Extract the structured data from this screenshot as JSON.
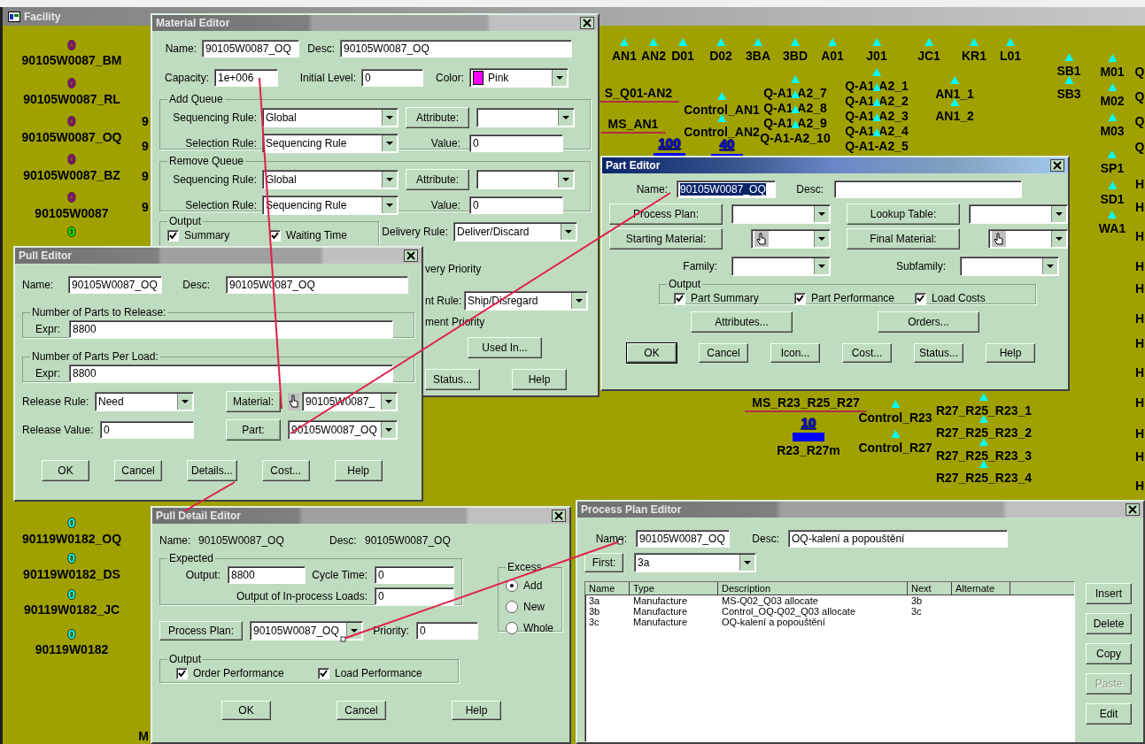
{
  "facility": {
    "title": "Facility",
    "counts": [
      {
        "text": "0",
        "color": "#a800a8",
        "kind": "plain"
      },
      {
        "text": "0",
        "color": "#a800a8",
        "kind": "plain"
      },
      {
        "text": "0",
        "color": "#a800a8",
        "kind": "plain"
      },
      {
        "text": "0",
        "color": "#a800a8",
        "kind": "plain"
      },
      {
        "text": "0",
        "color": "#a800a8",
        "kind": "plain"
      },
      {
        "text": "0",
        "color": "#00ff00",
        "kind": "plain"
      },
      {
        "text": "0",
        "color": "#00ffff",
        "kind": "plain"
      },
      {
        "text": "0",
        "color": "#00ffff",
        "kind": "plain"
      },
      {
        "text": "0",
        "color": "#00ffff",
        "kind": "plain"
      },
      {
        "text": "0",
        "color": "#00ffff",
        "kind": "plain"
      },
      {
        "text": "100",
        "color": "#0000ff",
        "kind": "queue"
      },
      {
        "text": "40",
        "color": "#0000ff",
        "kind": "queue"
      },
      {
        "text": "10",
        "color": "#0000ff",
        "kind": "queue"
      }
    ],
    "labels": [
      {
        "text": "90105W0087_BM",
        "marker": false,
        "underline": false
      },
      {
        "text": "90105W0087_RL",
        "marker": false,
        "underline": false
      },
      {
        "text": "90105W0087_OQ",
        "marker": false,
        "underline": false
      },
      {
        "text": "90105W0087_BZ",
        "marker": false,
        "underline": false
      },
      {
        "text": "90105W0087",
        "marker": false,
        "underline": false
      },
      {
        "text": "90119W0182_OQ",
        "marker": false,
        "underline": false
      },
      {
        "text": "90119W0182_DS",
        "marker": false,
        "underline": false
      },
      {
        "text": "90119W0182_JC",
        "marker": false,
        "underline": false
      },
      {
        "text": "90119W0182",
        "marker": false,
        "underline": false
      },
      {
        "text": "9",
        "marker": false,
        "underline": false
      },
      {
        "text": "9",
        "marker": false,
        "underline": false
      },
      {
        "text": "9",
        "marker": false,
        "underline": false
      },
      {
        "text": "9",
        "marker": false,
        "underline": false
      },
      {
        "text": "M",
        "marker": false,
        "underline": false
      },
      {
        "text": "AN1",
        "marker": true,
        "underline": false
      },
      {
        "text": "AN2",
        "marker": true,
        "underline": false
      },
      {
        "text": "D01",
        "marker": true,
        "underline": false
      },
      {
        "text": "D02",
        "marker": true,
        "underline": false
      },
      {
        "text": "3BA",
        "marker": true,
        "underline": false
      },
      {
        "text": "3BD",
        "marker": true,
        "underline": false
      },
      {
        "text": "A01",
        "marker": true,
        "underline": false
      },
      {
        "text": "J01",
        "marker": true,
        "underline": false
      },
      {
        "text": "JC1",
        "marker": true,
        "underline": false
      },
      {
        "text": "KR1",
        "marker": true,
        "underline": false
      },
      {
        "text": "L01",
        "marker": true,
        "underline": false
      },
      {
        "text": "SB1",
        "marker": true,
        "underline": false
      },
      {
        "text": "SB3",
        "marker": true,
        "underline": false
      },
      {
        "text": "M01",
        "marker": true,
        "underline": false
      },
      {
        "text": "M02",
        "marker": true,
        "underline": false
      },
      {
        "text": "M03",
        "marker": true,
        "underline": false
      },
      {
        "text": "SP1",
        "marker": true,
        "underline": false
      },
      {
        "text": "SD1",
        "marker": true,
        "underline": false
      },
      {
        "text": "WA1",
        "marker": true,
        "underline": false
      },
      {
        "text": "S_Q01-AN2",
        "marker": false,
        "underline": true
      },
      {
        "text": "MS_AN1",
        "marker": false,
        "underline": true
      },
      {
        "text": "Control_AN1",
        "marker": true,
        "underline": false
      },
      {
        "text": "Control_AN2",
        "marker": true,
        "underline": false
      },
      {
        "text": "Q-A1-A2_7",
        "marker": true,
        "underline": false
      },
      {
        "text": "Q-A1-A2_8",
        "marker": true,
        "underline": false
      },
      {
        "text": "Q-A1-A2_9",
        "marker": true,
        "underline": false
      },
      {
        "text": "Q-A1-A2_10",
        "marker": true,
        "underline": false
      },
      {
        "text": "Q-A1-A2_1",
        "marker": true,
        "underline": false
      },
      {
        "text": "Q-A1-A2_2",
        "marker": true,
        "underline": false
      },
      {
        "text": "Q-A1-A2_3",
        "marker": true,
        "underline": false
      },
      {
        "text": "Q-A1-A2_4",
        "marker": true,
        "underline": false
      },
      {
        "text": "Q-A1-A2_5",
        "marker": true,
        "underline": false
      },
      {
        "text": "AN1_1",
        "marker": true,
        "underline": false
      },
      {
        "text": "AN1_2",
        "marker": true,
        "underline": false
      },
      {
        "text": "MS_R23_R25_R27",
        "marker": false,
        "underline": true
      },
      {
        "text": "R23_R27m",
        "marker": false,
        "underline": false
      },
      {
        "text": "Control_R23",
        "marker": true,
        "underline": false
      },
      {
        "text": "Control_R27",
        "marker": true,
        "underline": false
      },
      {
        "text": "R27_R25_R23_1",
        "marker": true,
        "underline": false
      },
      {
        "text": "R27_R25_R23_2",
        "marker": true,
        "underline": false
      },
      {
        "text": "R27_R25_R23_3",
        "marker": true,
        "underline": false
      },
      {
        "text": "R27_R25_R23_4",
        "marker": true,
        "underline": false
      },
      {
        "text": "Q",
        "marker": false,
        "underline": false
      },
      {
        "text": "Q",
        "marker": false,
        "underline": false
      },
      {
        "text": "Q",
        "marker": false,
        "underline": false
      },
      {
        "text": "Q",
        "marker": false,
        "underline": false
      },
      {
        "text": "H",
        "marker": false,
        "underline": false
      },
      {
        "text": "H",
        "marker": false,
        "underline": false
      },
      {
        "text": "H",
        "marker": false,
        "underline": false
      },
      {
        "text": "H",
        "marker": false,
        "underline": false
      },
      {
        "text": "H",
        "marker": false,
        "underline": false
      },
      {
        "text": "H",
        "marker": false,
        "underline": false
      },
      {
        "text": "H",
        "marker": false,
        "underline": false
      },
      {
        "text": "H",
        "marker": false,
        "underline": false
      },
      {
        "text": "H",
        "marker": false,
        "underline": false
      },
      {
        "text": "H",
        "marker": false,
        "underline": false
      },
      {
        "text": "H",
        "marker": false,
        "underline": false
      },
      {
        "text": "H",
        "marker": false,
        "underline": false
      }
    ]
  },
  "material_editor": {
    "title": "Material Editor",
    "name": {
      "label": "Name:",
      "value": "90105W0087_OQ"
    },
    "desc": {
      "label": "Desc:",
      "value": "90105W0087_OQ"
    },
    "capacity": {
      "label": "Capacity:",
      "value": "1e+006"
    },
    "initial_level": {
      "label": "Initial Level:",
      "value": "0"
    },
    "color": {
      "label": "Color:",
      "value": "Pink",
      "color": "#ff00ff"
    },
    "queues": [
      {
        "title": "Add Queue",
        "sequencing_rule": {
          "label": "Sequencing Rule:",
          "value": "Global"
        },
        "selection_rule": {
          "label": "Selection Rule:",
          "value": "Sequencing Rule"
        },
        "attribute_button": "Attribute:",
        "value": {
          "label": "Value:",
          "value": "0"
        }
      },
      {
        "title": "Remove Queue",
        "sequencing_rule": {
          "label": "Sequencing Rule:",
          "value": "Global"
        },
        "selection_rule": {
          "label": "Selection Rule:",
          "value": "Sequencing Rule"
        },
        "attribute_button": "Attribute:",
        "value": {
          "label": "Value:",
          "value": "0"
        }
      }
    ],
    "output": {
      "title": "Output",
      "checks": [
        {
          "label": "Summary",
          "checked": true
        },
        {
          "label": "Waiting Time",
          "checked": true
        }
      ]
    },
    "delivery_rule": {
      "label": "Delivery Rule:",
      "value": "Deliver/Discard"
    },
    "delivery_priority": "very Priority",
    "shipment_rule": {
      "label": "nt Rule:",
      "value": "Ship/Disregard"
    },
    "shipment_priority": "ment Priority",
    "used_in": "Used In...",
    "buttons": [
      "Status...",
      "Help"
    ]
  },
  "part_editor": {
    "title": "Part Editor",
    "name": {
      "label": "Name:",
      "value": "90105W0087_OQ",
      "text_selected": true
    },
    "desc": {
      "label": "Desc:"
    },
    "selectors": [
      {
        "button": "Process Plan:",
        "kind": "plain"
      },
      {
        "button": "Lookup Table:",
        "kind": "plain"
      },
      {
        "button": "Starting Material:",
        "kind": "hand"
      },
      {
        "button": "Final Material:",
        "kind": "hand"
      }
    ],
    "family": {
      "label": "Family:"
    },
    "subfamily": {
      "label": "Subfamily:"
    },
    "output": {
      "title": "Output",
      "checks": [
        {
          "label": "Part Summary",
          "checked": true
        },
        {
          "label": "Part Performance",
          "checked": true
        },
        {
          "label": "Load Costs",
          "checked": true
        }
      ]
    },
    "mid_buttons": [
      "Attributes...",
      "Orders..."
    ],
    "buttons": [
      {
        "label": "OK",
        "default": true
      },
      {
        "label": "Cancel",
        "default": false
      },
      {
        "label": "Icon...",
        "default": false
      },
      {
        "label": "Cost...",
        "default": false
      },
      {
        "label": "Status...",
        "default": false
      },
      {
        "label": "Help",
        "default": false
      }
    ]
  },
  "pull_editor": {
    "title": "Pull Editor",
    "name": {
      "label": "Name:",
      "value": "90105W0087_OQ"
    },
    "desc": {
      "label": "Desc:",
      "value": "90105W0087_OQ"
    },
    "groups": [
      {
        "title": "Number of Parts to Release:",
        "label": "Expr:",
        "value": "8800"
      },
      {
        "title": "Number of Parts Per Load:",
        "label": "Expr:",
        "value": "8800"
      }
    ],
    "release_rule": {
      "label": "Release Rule:",
      "value": "Need"
    },
    "release_value": {
      "label": "Release Value:",
      "value": "0"
    },
    "material": {
      "button": "Material:",
      "value": "90105W0087_"
    },
    "part": {
      "button": "Part:",
      "value": "90105W0087_OQ"
    },
    "buttons": [
      "OK",
      "Cancel",
      "Details...",
      "Cost...",
      "Help"
    ]
  },
  "pull_detail_editor": {
    "title": "Pull Detail Editor",
    "name": {
      "label": "Name:",
      "value": "90105W0087_OQ"
    },
    "desc": {
      "label": "Desc:",
      "value": "90105W0087_OQ"
    },
    "expected": {
      "title": "Expected",
      "output": {
        "label": "Output:",
        "value": "8800"
      },
      "cycle_time": {
        "label": "Cycle Time:",
        "value": "0"
      },
      "in_process": {
        "label": "Output of In-process Loads:",
        "value": "0"
      }
    },
    "excess": {
      "title": "Excess",
      "options": [
        {
          "label": "Add",
          "selected": true
        },
        {
          "label": "New",
          "selected": false
        },
        {
          "label": "Whole",
          "selected": false
        }
      ]
    },
    "process_plan": {
      "button": "Process Plan:",
      "value": "90105W0087_OQ"
    },
    "priority": {
      "label": "Priority:",
      "value": "0"
    },
    "output": {
      "title": "Output",
      "checks": [
        {
          "label": "Order Performance",
          "checked": true
        },
        {
          "label": "Load Performance",
          "checked": true
        }
      ]
    },
    "buttons": [
      "OK",
      "Cancel",
      "Help"
    ]
  },
  "process_plan_editor": {
    "title": "Process Plan Editor",
    "name": {
      "label": "Name:",
      "value": "90105W0087_OQ"
    },
    "desc": {
      "label": "Desc:",
      "value": "OQ-kalení a popouštění"
    },
    "first": {
      "button": "First:",
      "value": "3a"
    },
    "table": {
      "columns": [
        "Name",
        "Type",
        "Description",
        "Next",
        "Alternate"
      ],
      "rows": [
        {
          "name": "3a",
          "type": "Manufacture",
          "description": "MS-Q02_Q03 allocate",
          "next": "3b"
        },
        {
          "name": "3b",
          "type": "Manufacture",
          "description": "Control_OQ-Q02_Q03 allocate",
          "next": "3c"
        },
        {
          "name": "3c",
          "type": "Manufacture",
          "description": "OQ-kalení a popouštění"
        }
      ]
    },
    "buttons": [
      {
        "label": "Insert",
        "disabled": false
      },
      {
        "label": "Delete",
        "disabled": false
      },
      {
        "label": "Copy",
        "disabled": false
      },
      {
        "label": "Paste",
        "disabled": true
      },
      {
        "label": "Edit",
        "disabled": false
      }
    ]
  }
}
